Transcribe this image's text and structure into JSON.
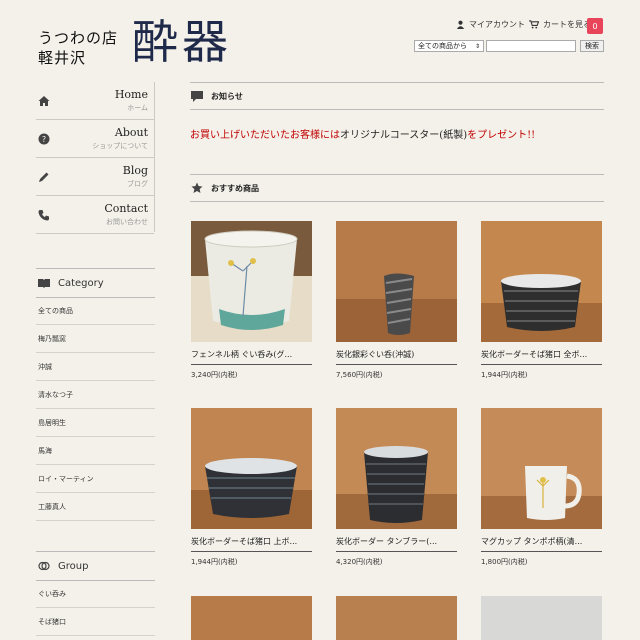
{
  "header": {
    "shop_subtitle_line1": "うつわの店",
    "shop_subtitle_line2": "軽井沢",
    "shop_logo": "酔器",
    "account_label": "マイアカウント",
    "cart_label": "カートを見る",
    "cart_count": "0",
    "search_scope": "全ての商品から",
    "search_placeholder": "",
    "search_button": "検索"
  },
  "nav": [
    {
      "title": "Home",
      "sub": "ホーム",
      "icon": "home-icon"
    },
    {
      "title": "About",
      "sub": "ショップについて",
      "icon": "question-icon"
    },
    {
      "title": "Blog",
      "sub": "ブログ",
      "icon": "pencil-icon"
    },
    {
      "title": "Contact",
      "sub": "お問い合わせ",
      "icon": "phone-icon"
    }
  ],
  "category": {
    "heading": "Category",
    "items": [
      "全ての商品",
      "梅乃瓢窯",
      "沖誠",
      "清水なつ子",
      "島居明生",
      "馬海",
      "ロイ・マーティン",
      "工藤真人"
    ]
  },
  "group": {
    "heading": "Group",
    "items": [
      "ぐい呑み",
      "そば猪口"
    ]
  },
  "notice": {
    "heading": "お知らせ",
    "text_part1": "お買い上げいただいたお客様には",
    "text_part2": "オリジナルコースター(紙製)",
    "text_part3": "をプレゼント!!"
  },
  "recommended": {
    "heading": "おすすめ商品",
    "products": [
      {
        "name": "フェンネル柄 ぐい呑み(グ...",
        "price": "3,240円(内税)"
      },
      {
        "name": "炭化銀彩ぐい呑(沖誠)",
        "price": "7,560円(内税)"
      },
      {
        "name": "炭化ボーダーそば猪口 全ボ...",
        "price": "1,944円(内税)"
      },
      {
        "name": "炭化ボーダーそば猪口 上ボ...",
        "price": "1,944円(内税)"
      },
      {
        "name": "炭化ボーダー タンブラー(...",
        "price": "4,320円(内税)"
      },
      {
        "name": "マグカップ タンポポ柄(清...",
        "price": "1,800円(内税)"
      }
    ]
  },
  "colors": {
    "background": "#f4f1ea",
    "logo": "#1f2a4a",
    "notice_red": "#c00000",
    "cart_badge": "#e8455a"
  }
}
